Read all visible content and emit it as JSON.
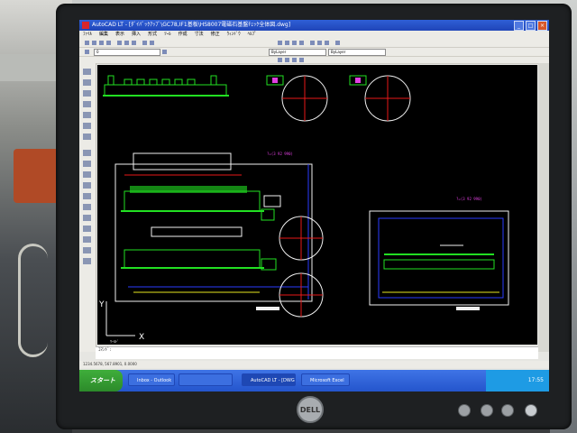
{
  "window": {
    "title": "AutoCAD LT - [ﾀﾞｲﾊﾞｯｸｱｯﾌﾟ\\GC78,IF1基板\\HS8007電磁石基盤ﾁｪｯｸ全体図.dwg]",
    "buttons": {
      "minimize": "_",
      "maximize": "□",
      "close": "×"
    }
  },
  "menu": [
    "ﾌｧｲﾙ",
    "編集",
    "表示",
    "挿入",
    "形式",
    "ﾂｰﾙ",
    "作成",
    "寸法",
    "修正",
    "ｳｨﾝﾄﾞｳ",
    "ﾍﾙﾌﾟ"
  ],
  "toolbar": {
    "layer_value": "0",
    "color_value": "ByLayer",
    "linetype_value": "ByLayer"
  },
  "drawing": {
    "axis_x": "X",
    "axis_y": "Y",
    "ucs_label": "ﾜｰﾙﾄﾞ",
    "annotations": [
      "?=(3 92 990)",
      "?=(3 92 990)"
    ]
  },
  "command_line": {
    "text": "ｺﾏﾝﾄﾞ:"
  },
  "status": {
    "coords": "1234.5678, 567.8901, 0.0000"
  },
  "taskbar": {
    "start": "スタート",
    "tasks": [
      "Inbox - Outlook",
      "",
      "AutoCAD LT - [DWG]",
      "Microsoft Excel"
    ],
    "clock": "17:55"
  },
  "monitor": {
    "brand": "DELL"
  },
  "colors": {
    "cad_background": "#000000",
    "green": "#22e022",
    "red": "#e81818",
    "white": "#f0f0f0",
    "blue": "#2a3cff",
    "magenta": "#e040e0",
    "yellow": "#e8e820"
  }
}
